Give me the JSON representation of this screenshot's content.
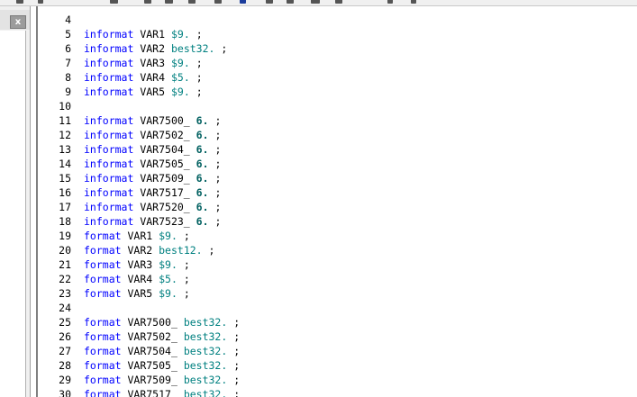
{
  "panel": {
    "close_label": "x"
  },
  "colors": {
    "keyword": "#0000ff",
    "format": "#008080",
    "background": "#ffffff"
  },
  "editor": {
    "lines": [
      {
        "num": "4",
        "kw": "",
        "var": "",
        "fmt": "",
        "bold": false,
        "semi": ""
      },
      {
        "num": "5",
        "kw": "informat",
        "var": "VAR1",
        "fmt": "$9.",
        "bold": false,
        "semi": ";"
      },
      {
        "num": "6",
        "kw": "informat",
        "var": "VAR2",
        "fmt": "best32.",
        "bold": false,
        "semi": ";"
      },
      {
        "num": "7",
        "kw": "informat",
        "var": "VAR3",
        "fmt": "$9.",
        "bold": false,
        "semi": ";"
      },
      {
        "num": "8",
        "kw": "informat",
        "var": "VAR4",
        "fmt": "$5.",
        "bold": false,
        "semi": ";"
      },
      {
        "num": "9",
        "kw": "informat",
        "var": "VAR5",
        "fmt": "$9.",
        "bold": false,
        "semi": ";"
      },
      {
        "num": "10",
        "kw": "",
        "var": "",
        "fmt": "",
        "bold": false,
        "semi": ""
      },
      {
        "num": "11",
        "kw": "informat",
        "var": "VAR7500_",
        "fmt": "6.",
        "bold": true,
        "semi": ";"
      },
      {
        "num": "12",
        "kw": "informat",
        "var": "VAR7502_",
        "fmt": "6.",
        "bold": true,
        "semi": ";"
      },
      {
        "num": "13",
        "kw": "informat",
        "var": "VAR7504_",
        "fmt": "6.",
        "bold": true,
        "semi": ";"
      },
      {
        "num": "14",
        "kw": "informat",
        "var": "VAR7505_",
        "fmt": "6.",
        "bold": true,
        "semi": ";"
      },
      {
        "num": "15",
        "kw": "informat",
        "var": "VAR7509_",
        "fmt": "6.",
        "bold": true,
        "semi": ";"
      },
      {
        "num": "16",
        "kw": "informat",
        "var": "VAR7517_",
        "fmt": "6.",
        "bold": true,
        "semi": ";"
      },
      {
        "num": "17",
        "kw": "informat",
        "var": "VAR7520_",
        "fmt": "6.",
        "bold": true,
        "semi": ";"
      },
      {
        "num": "18",
        "kw": "informat",
        "var": "VAR7523_",
        "fmt": "6.",
        "bold": true,
        "semi": ";"
      },
      {
        "num": "19",
        "kw": "format",
        "var": "VAR1",
        "fmt": "$9.",
        "bold": false,
        "semi": ";"
      },
      {
        "num": "20",
        "kw": "format",
        "var": "VAR2",
        "fmt": "best12.",
        "bold": false,
        "semi": ";"
      },
      {
        "num": "21",
        "kw": "format",
        "var": "VAR3",
        "fmt": "$9.",
        "bold": false,
        "semi": ";"
      },
      {
        "num": "22",
        "kw": "format",
        "var": "VAR4",
        "fmt": "$5.",
        "bold": false,
        "semi": ";"
      },
      {
        "num": "23",
        "kw": "format",
        "var": "VAR5",
        "fmt": "$9.",
        "bold": false,
        "semi": ";"
      },
      {
        "num": "24",
        "kw": "",
        "var": "",
        "fmt": "",
        "bold": false,
        "semi": ""
      },
      {
        "num": "25",
        "kw": "format",
        "var": "VAR7500_",
        "fmt": "best32.",
        "bold": false,
        "semi": ";"
      },
      {
        "num": "26",
        "kw": "format",
        "var": "VAR7502_",
        "fmt": "best32.",
        "bold": false,
        "semi": ";"
      },
      {
        "num": "27",
        "kw": "format",
        "var": "VAR7504_",
        "fmt": "best32.",
        "bold": false,
        "semi": ";"
      },
      {
        "num": "28",
        "kw": "format",
        "var": "VAR7505_",
        "fmt": "best32.",
        "bold": false,
        "semi": ";"
      },
      {
        "num": "29",
        "kw": "format",
        "var": "VAR7509_",
        "fmt": "best32.",
        "bold": false,
        "semi": ";"
      },
      {
        "num": "30",
        "kw": "format",
        "var": "VAR7517_",
        "fmt": "best32.",
        "bold": false,
        "semi": ";"
      }
    ]
  }
}
